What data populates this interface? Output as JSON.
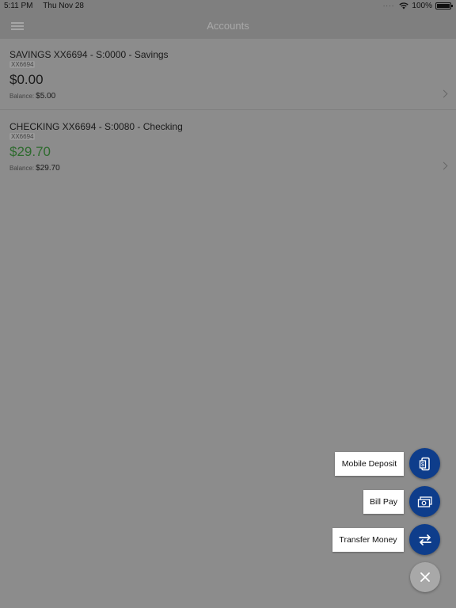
{
  "status_bar": {
    "time": "5:11 PM",
    "date": "Thu Nov 28",
    "battery": "100%",
    "battery_level": 1.0
  },
  "nav": {
    "title": "Accounts",
    "menu_icon": "hamburger-menu-icon"
  },
  "accounts": [
    {
      "name": "SAVINGS XX6694 - S:0000 - Savings",
      "mask": "XX6694",
      "amount": "$0.00",
      "balance_label": "Balance:",
      "balance": "$5.00"
    },
    {
      "name": "CHECKING XX6694 - S:0080 - Checking",
      "mask": "XX6694",
      "amount": "$29.70",
      "balance_label": "Balance:",
      "balance": "$29.70"
    }
  ],
  "actions": [
    {
      "label": "Mobile Deposit",
      "icon": "mobile-deposit-icon"
    },
    {
      "label": "Bill Pay",
      "icon": "bill-pay-icon"
    },
    {
      "label": "Transfer Money",
      "icon": "transfer-arrows-icon"
    }
  ],
  "close_icon": "close-icon",
  "colors": {
    "fab": "#0e3d8b",
    "positive_amount": "#2e6b2e"
  }
}
